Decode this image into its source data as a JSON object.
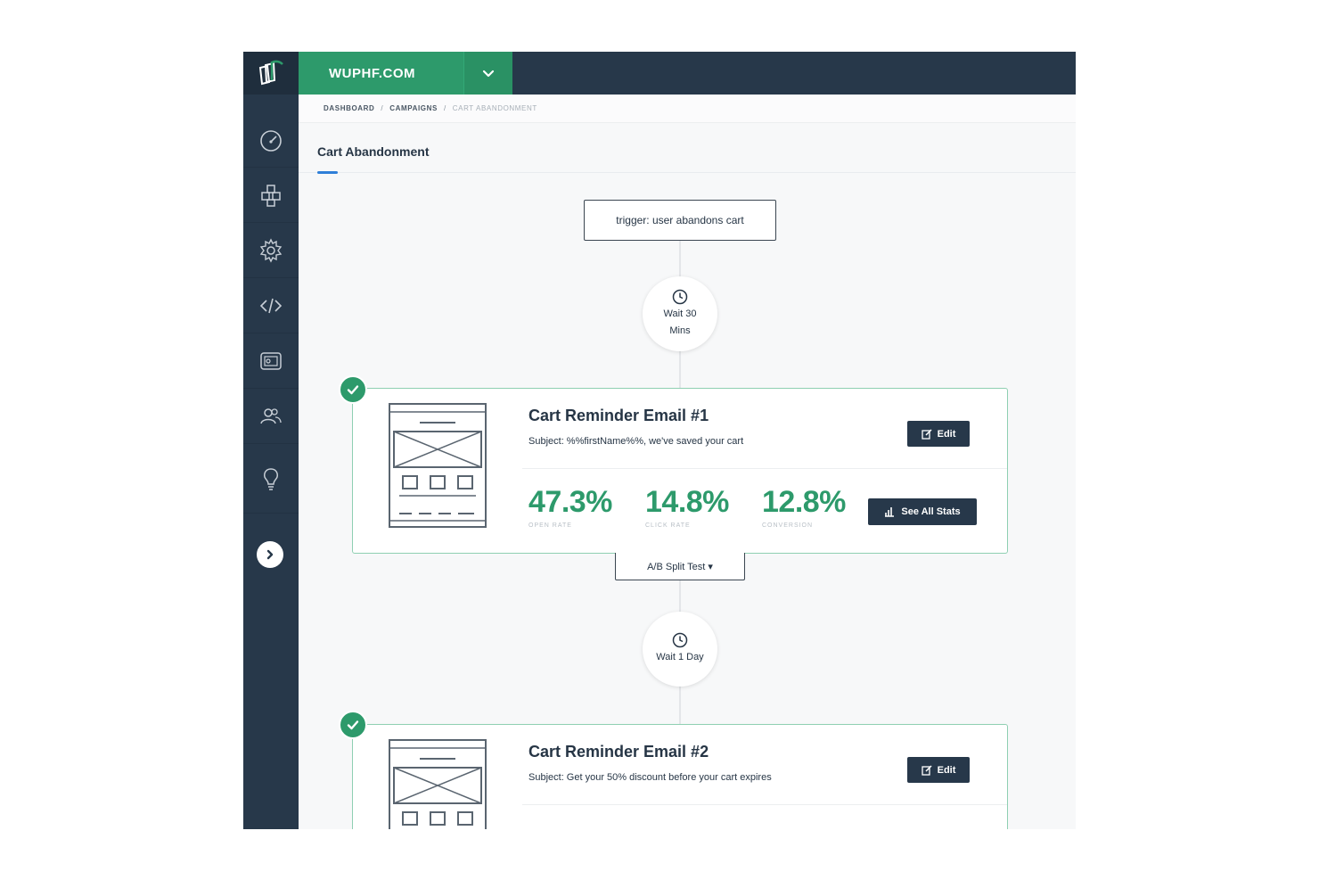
{
  "app": {
    "site_name": "WUPHF.COM",
    "brand_color": "#2d9a6b",
    "nav_color": "#27384a",
    "accent_color": "#2f7fd8"
  },
  "sidebar": {
    "items": [
      {
        "name": "dashboard",
        "icon": "gauge-icon"
      },
      {
        "name": "campaigns",
        "icon": "cubes-icon"
      },
      {
        "name": "settings",
        "icon": "gear-icon"
      },
      {
        "name": "developer",
        "icon": "code-icon"
      },
      {
        "name": "templates",
        "icon": "money-icon"
      },
      {
        "name": "audience",
        "icon": "users-icon"
      },
      {
        "name": "ideas",
        "icon": "lightbulb-icon"
      }
    ],
    "expand_icon": "chevron-right-circle-icon"
  },
  "breadcrumb": {
    "items": [
      "DASHBOARD",
      "CAMPAIGNS",
      "CART ABANDONMENT"
    ],
    "separator": "/"
  },
  "page": {
    "title": "Cart Abandonment"
  },
  "flow": {
    "trigger": "trigger: user abandons cart",
    "wait1": "Wait 30 Mins",
    "wait2": "Wait 1 Day",
    "ab_test": "A/B Split Test ▾",
    "emails": [
      {
        "title": "Cart Reminder Email #1",
        "subject": "Subject: %%firstName%%, we've saved your cart",
        "edit_label": "Edit",
        "stats": [
          {
            "value": "47.3%",
            "label": "OPEN RATE"
          },
          {
            "value": "14.8%",
            "label": "CLICK RATE"
          },
          {
            "value": "12.8%",
            "label": "CONVERSION"
          }
        ],
        "stats_button": "See All Stats"
      },
      {
        "title": "Cart Reminder Email #2",
        "subject": "Subject: Get your 50% discount before your cart expires",
        "edit_label": "Edit"
      }
    ]
  }
}
